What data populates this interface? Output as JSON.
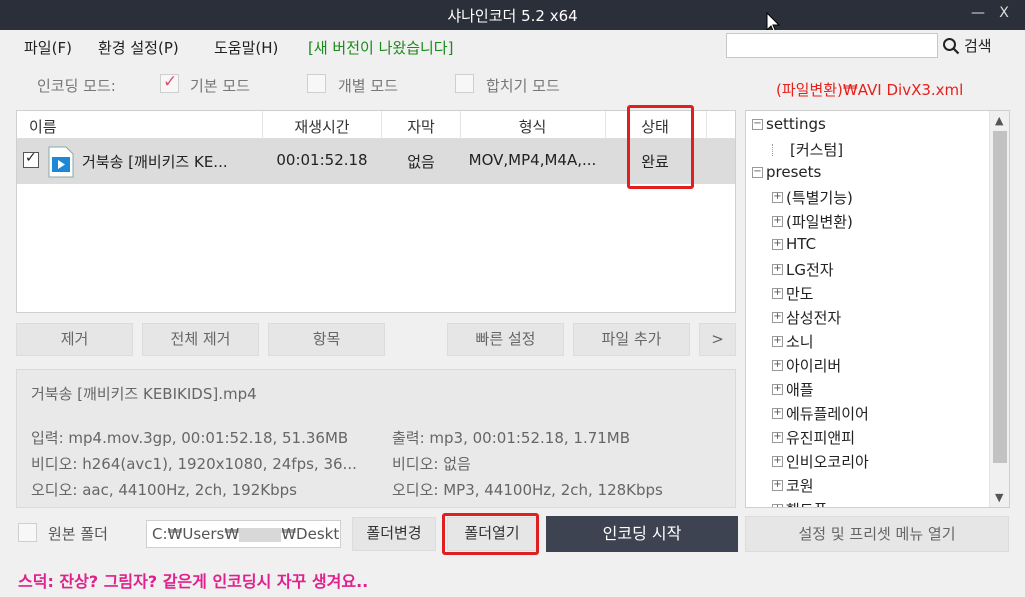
{
  "window": {
    "title": "샤나인코더  5.2 x64",
    "min_glyph": "—",
    "close_glyph": "X"
  },
  "menu": {
    "file": "파일(F)",
    "settings": "환경 설정(P)",
    "help": "도움말(H)",
    "notice": "[새 버전이 나왔습니다]"
  },
  "search": {
    "value": "",
    "button_label": "검색",
    "icon": "search-icon"
  },
  "encode_mode": {
    "label": "인코딩 모드:",
    "options": [
      {
        "label": "기본 모드",
        "checked": true
      },
      {
        "label": "개별 모드",
        "checked": false
      },
      {
        "label": "합치기 모드",
        "checked": false
      }
    ]
  },
  "current_preset": "(파일변환)₩AVI DivX3.xml",
  "file_table": {
    "columns": [
      "이름",
      "재생시간",
      "자막",
      "형식",
      "상태"
    ],
    "rows": [
      {
        "checked": true,
        "name": "거북송 [깨비키즈 KE...",
        "duration": "00:01:52.18",
        "subtitle": "없음",
        "format": "MOV,MP4,M4A,...",
        "status": "완료"
      }
    ]
  },
  "list_buttons": {
    "remove": "제거",
    "remove_all": "전체 제거",
    "item": "항목",
    "quick_settings": "빠른 설정",
    "add_file": "파일 추가",
    "more": ">"
  },
  "info": {
    "filename": "거북송 [깨비키즈 KEBIKIDS].mp4",
    "input": "입력: mp4.mov.3gp, 00:01:52.18, 51.36MB",
    "video_in": "비디오: h264(avc1), 1920x1080, 24fps, 36...",
    "audio_in": "오디오: aac, 44100Hz, 2ch, 192Kbps",
    "output": "출력: mp3, 00:01:52.18, 1.71MB",
    "video_out": "비디오: 없음",
    "audio_out": "오디오: MP3, 44100Hz, 2ch, 128Kbps"
  },
  "tree": {
    "items": [
      {
        "label": "settings",
        "level": 0,
        "box": "⊟"
      },
      {
        "label": "[커스텀]",
        "level": 1,
        "box": ""
      },
      {
        "label": "presets",
        "level": 0,
        "box": "⊟"
      },
      {
        "label": "(특별기능)",
        "level": 1,
        "box": "+"
      },
      {
        "label": "(파일변환)",
        "level": 1,
        "box": "+"
      },
      {
        "label": "HTC",
        "level": 1,
        "box": "+"
      },
      {
        "label": "LG전자",
        "level": 1,
        "box": "+"
      },
      {
        "label": "만도",
        "level": 1,
        "box": "+"
      },
      {
        "label": "삼성전자",
        "level": 1,
        "box": "+"
      },
      {
        "label": "소니",
        "level": 1,
        "box": "+"
      },
      {
        "label": "아이리버",
        "level": 1,
        "box": "+"
      },
      {
        "label": "애플",
        "level": 1,
        "box": "+"
      },
      {
        "label": "에듀플레이어",
        "level": 1,
        "box": "+"
      },
      {
        "label": "유진피앤피",
        "level": 1,
        "box": "+"
      },
      {
        "label": "인비오코리아",
        "level": 1,
        "box": "+"
      },
      {
        "label": "코원",
        "level": 1,
        "box": "+"
      },
      {
        "label": "핸드폰",
        "level": 1,
        "box": "+"
      }
    ]
  },
  "bottom": {
    "source_folder_label": "원본 폴더",
    "folder_path_prefix": "C:₩Users₩",
    "folder_path_suffix": "₩Desktop",
    "change_folder": "폴더변경",
    "open_folder": "폴더열기",
    "start_encoding": "인코딩 시작",
    "open_settings_menu": "설정 및 프리셋 메뉴 열기"
  },
  "tip": "스덕: 잔상? 그림자? 같은게 인코딩시 자꾸 생겨요..",
  "colors": {
    "highlight_box": "#e02020",
    "notice": "#1a8a1a",
    "preset_path": "#e8201c",
    "tip": "#e0208c",
    "titlebar": "#2b2f3a"
  }
}
